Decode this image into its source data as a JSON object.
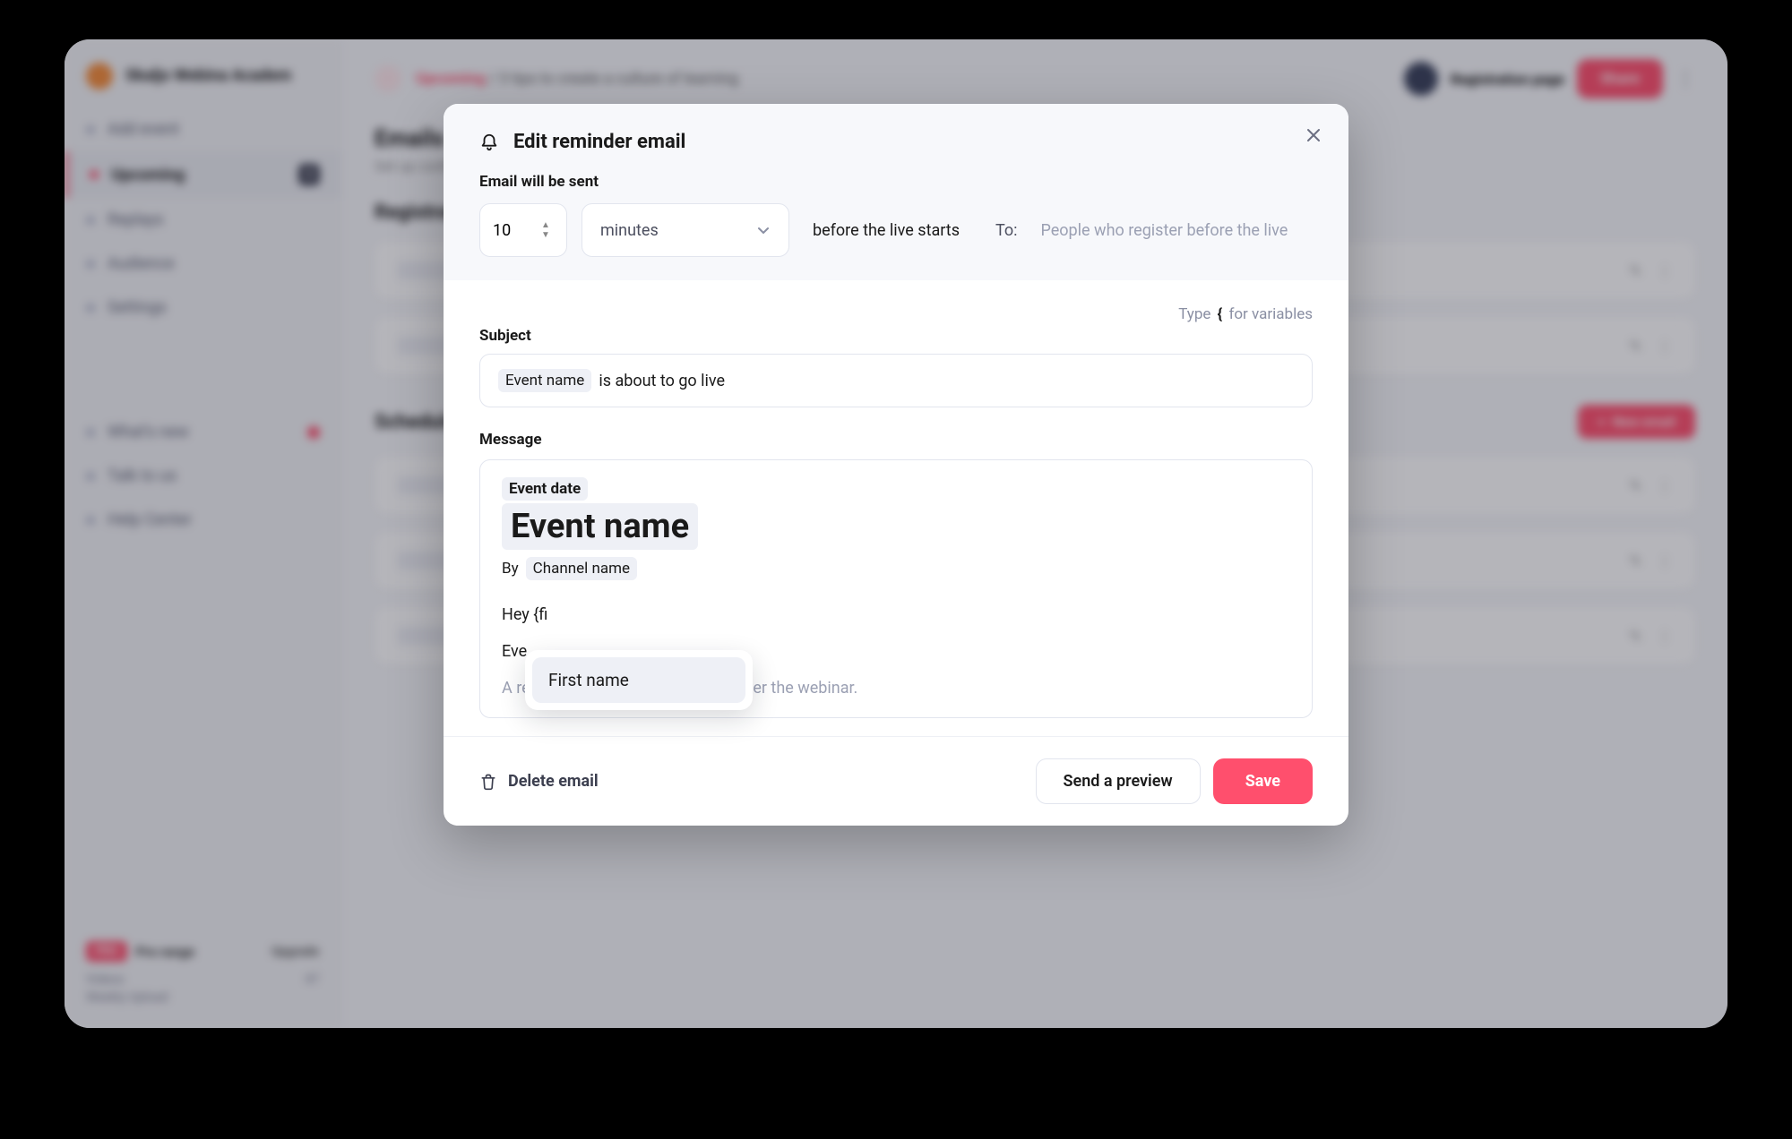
{
  "brand": {
    "title": "Skaljo Webina\nAcadem"
  },
  "sidebar": {
    "items": [
      {
        "label": "Add event"
      },
      {
        "label": "Upcoming",
        "badge": "3"
      },
      {
        "label": "Replays",
        "badge": ""
      },
      {
        "label": "Audience"
      },
      {
        "label": "Settings"
      }
    ],
    "lower": [
      {
        "label": "What's new"
      },
      {
        "label": "Talk to us"
      },
      {
        "label": "Help Center"
      }
    ],
    "footer": {
      "pro_badge": "PRO",
      "pro_text": "Pro range",
      "pro_link": "Upgrade",
      "stats": [
        {
          "label": "Videos",
          "value": "47"
        },
        {
          "label": "Weekly Upload",
          "value": ""
        }
      ]
    }
  },
  "topbar": {
    "breadcrumb_root": "Upcoming",
    "breadcrumb_page": "3 tips to create a culture of learning",
    "reg_link": "Registration page",
    "share": "Share"
  },
  "page": {
    "h1": "Emails",
    "h1_sub": "Set up confirmation and reminder emails",
    "reg_title": "Registration",
    "sched_title": "Scheduled emails",
    "new_email": "New email"
  },
  "modal": {
    "title": "Edit reminder email",
    "send_label": "Email will be sent",
    "time_value": "10",
    "unit_value": "minutes",
    "before_text": "before the live starts",
    "to_label": "To:",
    "to_value": "People who register before the live",
    "type_hint_pre": "Type",
    "type_hint_brace": "{",
    "type_hint_post": "for variables",
    "subject_label": "Subject",
    "subject_token": "Event name",
    "subject_rest": "is about to go live",
    "message_label": "Message",
    "msg_date_token": "Event date",
    "msg_event_token": "Event name",
    "msg_by_label": "By",
    "msg_channel_token": "Channel name",
    "msg_hey": "Hey {fi",
    "msg_evepartial": "Eve",
    "msg_replay": "A replay will be available shortly after the webinar.",
    "autocomplete": "First name",
    "delete": "Delete email",
    "preview": "Send a preview",
    "save": "Save"
  }
}
